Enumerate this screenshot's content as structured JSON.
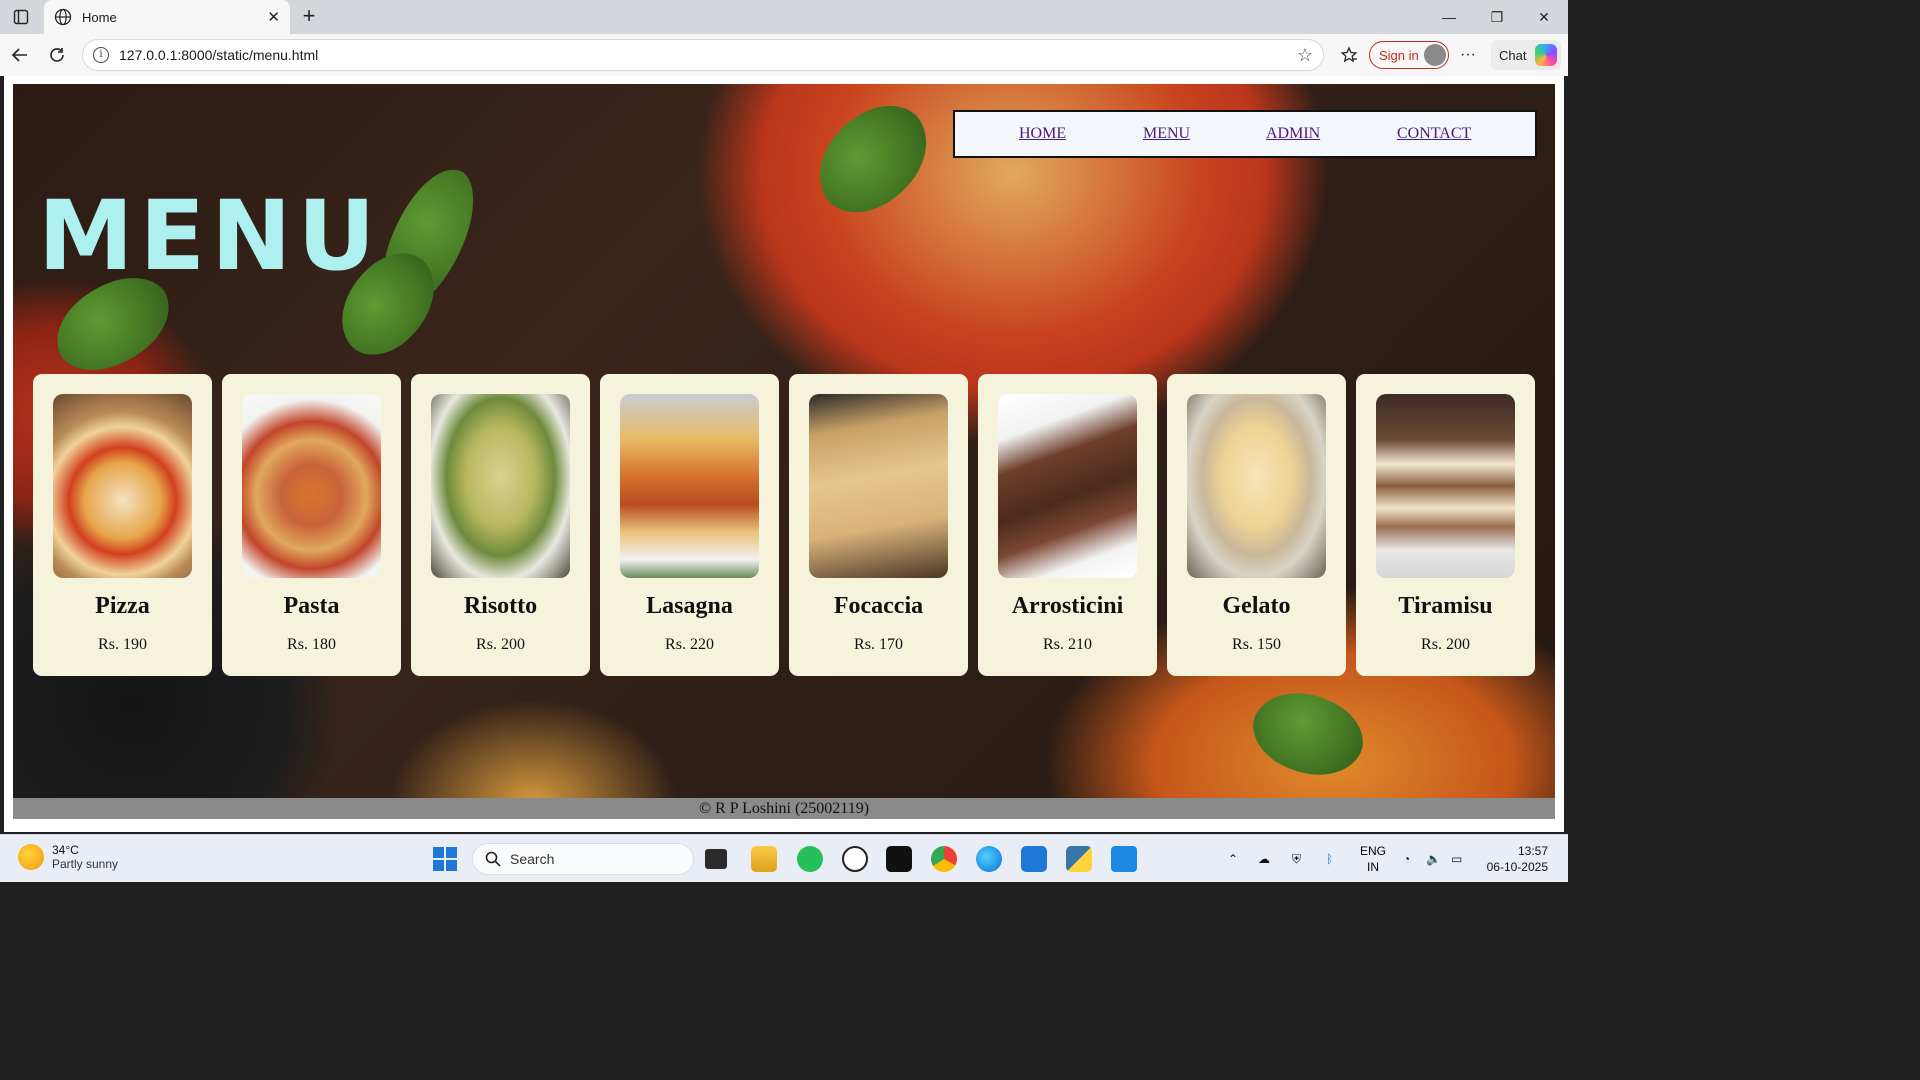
{
  "browser": {
    "tab_title": "Home",
    "url": "127.0.0.1:8000/static/menu.html",
    "signin_label": "Sign in",
    "chat_label": "Chat"
  },
  "nav": {
    "home": "HOME",
    "menu": "MENU",
    "admin": "ADMIN",
    "contact": "CONTACT"
  },
  "page": {
    "heading": "MENU",
    "footer": "© R P Loshini (25002119)"
  },
  "items": [
    {
      "name": "Pizza",
      "price": "Rs. 190"
    },
    {
      "name": "Pasta",
      "price": "Rs. 180"
    },
    {
      "name": "Risotto",
      "price": "Rs. 200"
    },
    {
      "name": "Lasagna",
      "price": "Rs. 220"
    },
    {
      "name": "Focaccia",
      "price": "Rs. 170"
    },
    {
      "name": "Arrosticini",
      "price": "Rs. 210"
    },
    {
      "name": "Gelato",
      "price": "Rs. 150"
    },
    {
      "name": "Tiramisu",
      "price": "Rs. 200"
    }
  ],
  "taskbar": {
    "weather_temp": "34°C",
    "weather_desc": "Partly sunny",
    "search_label": "Search",
    "lang_line1": "ENG",
    "lang_line2": "IN",
    "time": "13:57",
    "date": "06-10-2025"
  },
  "colors": {
    "menu_heading": "#aeeff0",
    "card_bg": "#f5f3dc",
    "nav_link": "#4b1a7a",
    "footer_bg": "#8a8a8a"
  }
}
